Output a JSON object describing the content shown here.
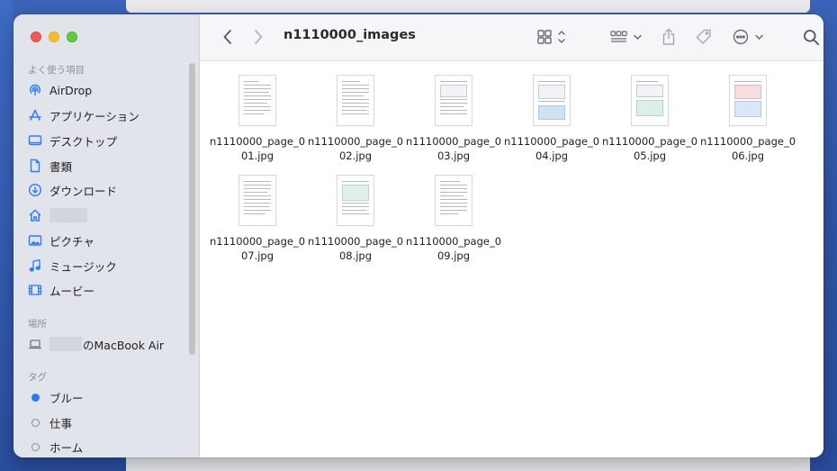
{
  "window": {
    "title": "n1110000_images"
  },
  "sidebar": {
    "favorites_title": "よく使う項目",
    "favorites": [
      {
        "label": "AirDrop",
        "icon": "airdrop-icon"
      },
      {
        "label": "アプリケーション",
        "icon": "applications-icon"
      },
      {
        "label": "デスクトップ",
        "icon": "desktop-icon"
      },
      {
        "label": "書類",
        "icon": "document-icon"
      },
      {
        "label": "ダウンロード",
        "icon": "download-icon"
      },
      {
        "label": "",
        "icon": "home-icon"
      },
      {
        "label": "ピクチャ",
        "icon": "pictures-icon"
      },
      {
        "label": "ミュージック",
        "icon": "music-icon"
      },
      {
        "label": "ムービー",
        "icon": "movies-icon"
      }
    ],
    "locations_title": "場所",
    "locations": [
      {
        "label": "のMacBook Air",
        "icon": "laptop-icon"
      }
    ],
    "tags_title": "タグ",
    "tags": [
      {
        "label": "ブルー",
        "color": "#2a78f0"
      },
      {
        "label": "仕事",
        "color": ""
      },
      {
        "label": "ホーム",
        "color": ""
      }
    ]
  },
  "files": [
    {
      "name": "n1110000_page_001.jpg"
    },
    {
      "name": "n1110000_page_002.jpg"
    },
    {
      "name": "n1110000_page_003.jpg"
    },
    {
      "name": "n1110000_page_004.jpg"
    },
    {
      "name": "n1110000_page_005.jpg"
    },
    {
      "name": "n1110000_page_006.jpg"
    },
    {
      "name": "n1110000_page_007.jpg"
    },
    {
      "name": "n1110000_page_008.jpg"
    },
    {
      "name": "n1110000_page_009.jpg"
    }
  ],
  "colors": {
    "accent": "#2f7cf6",
    "sidebar_bg": "#e2e4ec",
    "close": "#ee5a52",
    "minimize": "#f3bd2f",
    "zoom": "#5fc83e"
  }
}
